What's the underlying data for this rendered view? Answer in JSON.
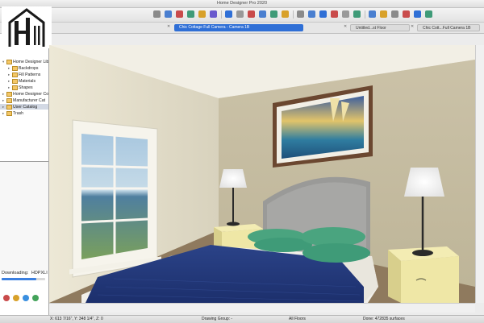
{
  "window": {
    "title": "Home Designer Pro 2020"
  },
  "tabs": [
    {
      "label": "Chic Cottage Full Camera - Camera 1B",
      "active": true
    },
    {
      "label": "Untitled...st Floor",
      "active": false
    },
    {
      "label": "Chic Cott...Full Camera 1B",
      "active": false
    }
  ],
  "library": {
    "items": [
      {
        "label": "Home Designer Lib",
        "expanded": true,
        "selected": false,
        "indent": 0
      },
      {
        "label": "Backdrops",
        "selected": false,
        "indent": 1
      },
      {
        "label": "Fill Patterns",
        "selected": false,
        "indent": 1
      },
      {
        "label": "Materials",
        "selected": false,
        "indent": 1
      },
      {
        "label": "Shapes",
        "selected": false,
        "indent": 1
      },
      {
        "label": "Home Designer Co",
        "selected": false,
        "indent": 0
      },
      {
        "label": "Manufacturer Cat",
        "selected": false,
        "indent": 0
      },
      {
        "label": "User Catalog",
        "selected": true,
        "indent": 0
      },
      {
        "label": "Trash",
        "selected": false,
        "indent": 0
      }
    ]
  },
  "download": {
    "label": "Downloading:",
    "value": "HDPXLI",
    "progress": 0.8
  },
  "status": {
    "coords": "X: 613 7/16\", Y: 348 1/4\", Z: 0",
    "group": "Drawing Group: -",
    "floors": "All Floors",
    "surfaces": "Done: 472835 surfaces"
  },
  "colors": {
    "accent": "#2f6fd6",
    "wall_side": "#e7e2cf",
    "wall_back": "#cfc7b0",
    "ceiling": "#efece0",
    "duvet": "#233a7e",
    "pillow": "#3f9b78",
    "nightstand": "#efe7a6",
    "headboard": "#9a9a98"
  },
  "icons": [
    "undo-icon",
    "redo-icon",
    "select-icon",
    "wall-icon",
    "door-icon",
    "window-icon",
    "camera-icon",
    "zoom-icon",
    "help-icon"
  ]
}
